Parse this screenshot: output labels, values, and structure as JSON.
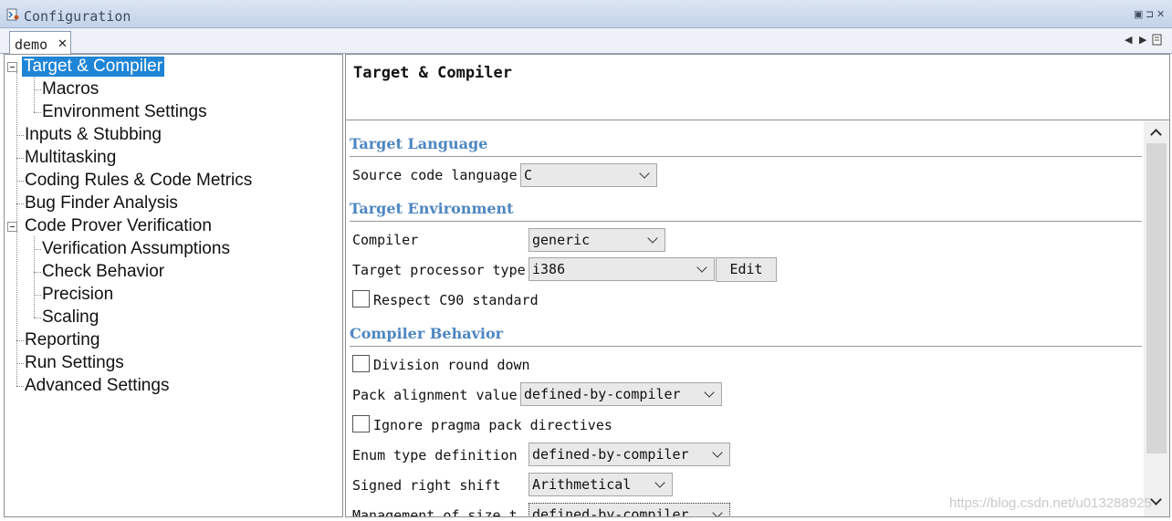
{
  "window": {
    "title": "Configuration",
    "icon": "config-app-icon",
    "controls": [
      "restore-icon",
      "pin-icon",
      "close-icon"
    ]
  },
  "tabs": [
    {
      "label": "demo",
      "close": "✕"
    }
  ],
  "tab_nav": {
    "left": "◀",
    "right": "▶"
  },
  "tree": {
    "items": [
      {
        "label": "Target & Compiler",
        "level": 0,
        "expanded": true,
        "selected": true
      },
      {
        "label": "Macros",
        "level": 1
      },
      {
        "label": "Environment Settings",
        "level": 1
      },
      {
        "label": "Inputs & Stubbing",
        "level": 0
      },
      {
        "label": "Multitasking",
        "level": 0
      },
      {
        "label": "Coding Rules & Code Metrics",
        "level": 0
      },
      {
        "label": "Bug Finder Analysis",
        "level": 0
      },
      {
        "label": "Code Prover Verification",
        "level": 0,
        "expanded": true
      },
      {
        "label": "Verification Assumptions",
        "level": 1
      },
      {
        "label": "Check Behavior",
        "level": 1
      },
      {
        "label": "Precision",
        "level": 1
      },
      {
        "label": "Scaling",
        "level": 1
      },
      {
        "label": "Reporting",
        "level": 0
      },
      {
        "label": "Run Settings",
        "level": 0
      },
      {
        "label": "Advanced Settings",
        "level": 0
      }
    ]
  },
  "panel": {
    "header_title": "Target & Compiler",
    "sections": {
      "target_language": "Target Language",
      "target_environment": "Target Environment",
      "compiler_behavior": "Compiler Behavior"
    },
    "fields": {
      "source_code_language": {
        "label": "Source code language",
        "value": "C"
      },
      "compiler": {
        "label": "Compiler",
        "value": "generic"
      },
      "target_processor_type": {
        "label": "Target processor type",
        "value": "i386",
        "button": "Edit"
      },
      "respect_c90": {
        "label": "Respect C90 standard",
        "checked": false
      },
      "division_round_down": {
        "label": "Division round down",
        "checked": false
      },
      "pack_alignment_value": {
        "label": "Pack alignment value",
        "value": "defined-by-compiler"
      },
      "ignore_pragma_pack": {
        "label": "Ignore pragma pack directives",
        "checked": false
      },
      "enum_type_definition": {
        "label": "Enum type definition",
        "value": "defined-by-compiler"
      },
      "signed_right_shift": {
        "label": "Signed right shift",
        "value": "Arithmetical"
      },
      "management_of_size_t": {
        "label": "Management of size_t",
        "value": "defined-by-compiler"
      }
    }
  },
  "watermark": "https://blog.csdn.net/u013288925"
}
